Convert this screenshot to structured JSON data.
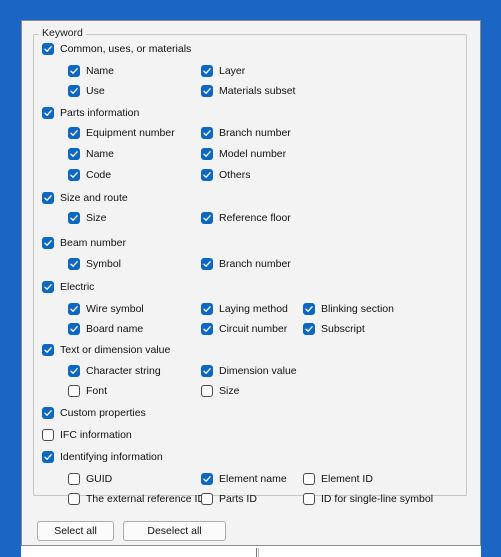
{
  "group": {
    "label": "Keyword"
  },
  "items": [
    {
      "label": "Common, uses, or materials",
      "checked": true
    },
    {
      "label": "Name",
      "checked": true
    },
    {
      "label": "Layer",
      "checked": true
    },
    {
      "label": "Use",
      "checked": true
    },
    {
      "label": "Materials subset",
      "checked": true
    },
    {
      "label": "Parts information",
      "checked": true
    },
    {
      "label": "Equipment number",
      "checked": true
    },
    {
      "label": "Branch number",
      "checked": true
    },
    {
      "label": "Name",
      "checked": true
    },
    {
      "label": "Model number",
      "checked": true
    },
    {
      "label": "Code",
      "checked": true
    },
    {
      "label": "Others",
      "checked": true
    },
    {
      "label": "Size and route",
      "checked": true
    },
    {
      "label": "Size",
      "checked": true
    },
    {
      "label": "Reference floor",
      "checked": true
    },
    {
      "label": "Beam number",
      "checked": true
    },
    {
      "label": "Symbol",
      "checked": true
    },
    {
      "label": "Branch number",
      "checked": true
    },
    {
      "label": "Electric",
      "checked": true
    },
    {
      "label": "Wire symbol",
      "checked": true
    },
    {
      "label": "Laying method",
      "checked": true
    },
    {
      "label": "Blinking section",
      "checked": true
    },
    {
      "label": "Board name",
      "checked": true
    },
    {
      "label": "Circuit number",
      "checked": true
    },
    {
      "label": "Subscript",
      "checked": true
    },
    {
      "label": "Text or dimension value",
      "checked": true
    },
    {
      "label": "Character string",
      "checked": true
    },
    {
      "label": "Dimension value",
      "checked": true
    },
    {
      "label": "Font",
      "checked": false
    },
    {
      "label": "Size",
      "checked": false
    },
    {
      "label": "Custom properties",
      "checked": true
    },
    {
      "label": "IFC information",
      "checked": false
    },
    {
      "label": "Identifying information",
      "checked": true
    },
    {
      "label": "GUID",
      "checked": false
    },
    {
      "label": "Element name",
      "checked": true
    },
    {
      "label": "Element ID",
      "checked": false
    },
    {
      "label": "The external reference ID",
      "checked": false
    },
    {
      "label": "Parts ID",
      "checked": false
    },
    {
      "label": "ID for single-line symbol",
      "checked": false
    }
  ],
  "buttons": {
    "select_all": "Select all",
    "deselect_all": "Deselect all"
  },
  "colors": {
    "checked": "#0a67c2",
    "background": "#1b66c4",
    "panel": "#f3f3f3"
  },
  "icons": {
    "check": "checkmark-icon"
  }
}
